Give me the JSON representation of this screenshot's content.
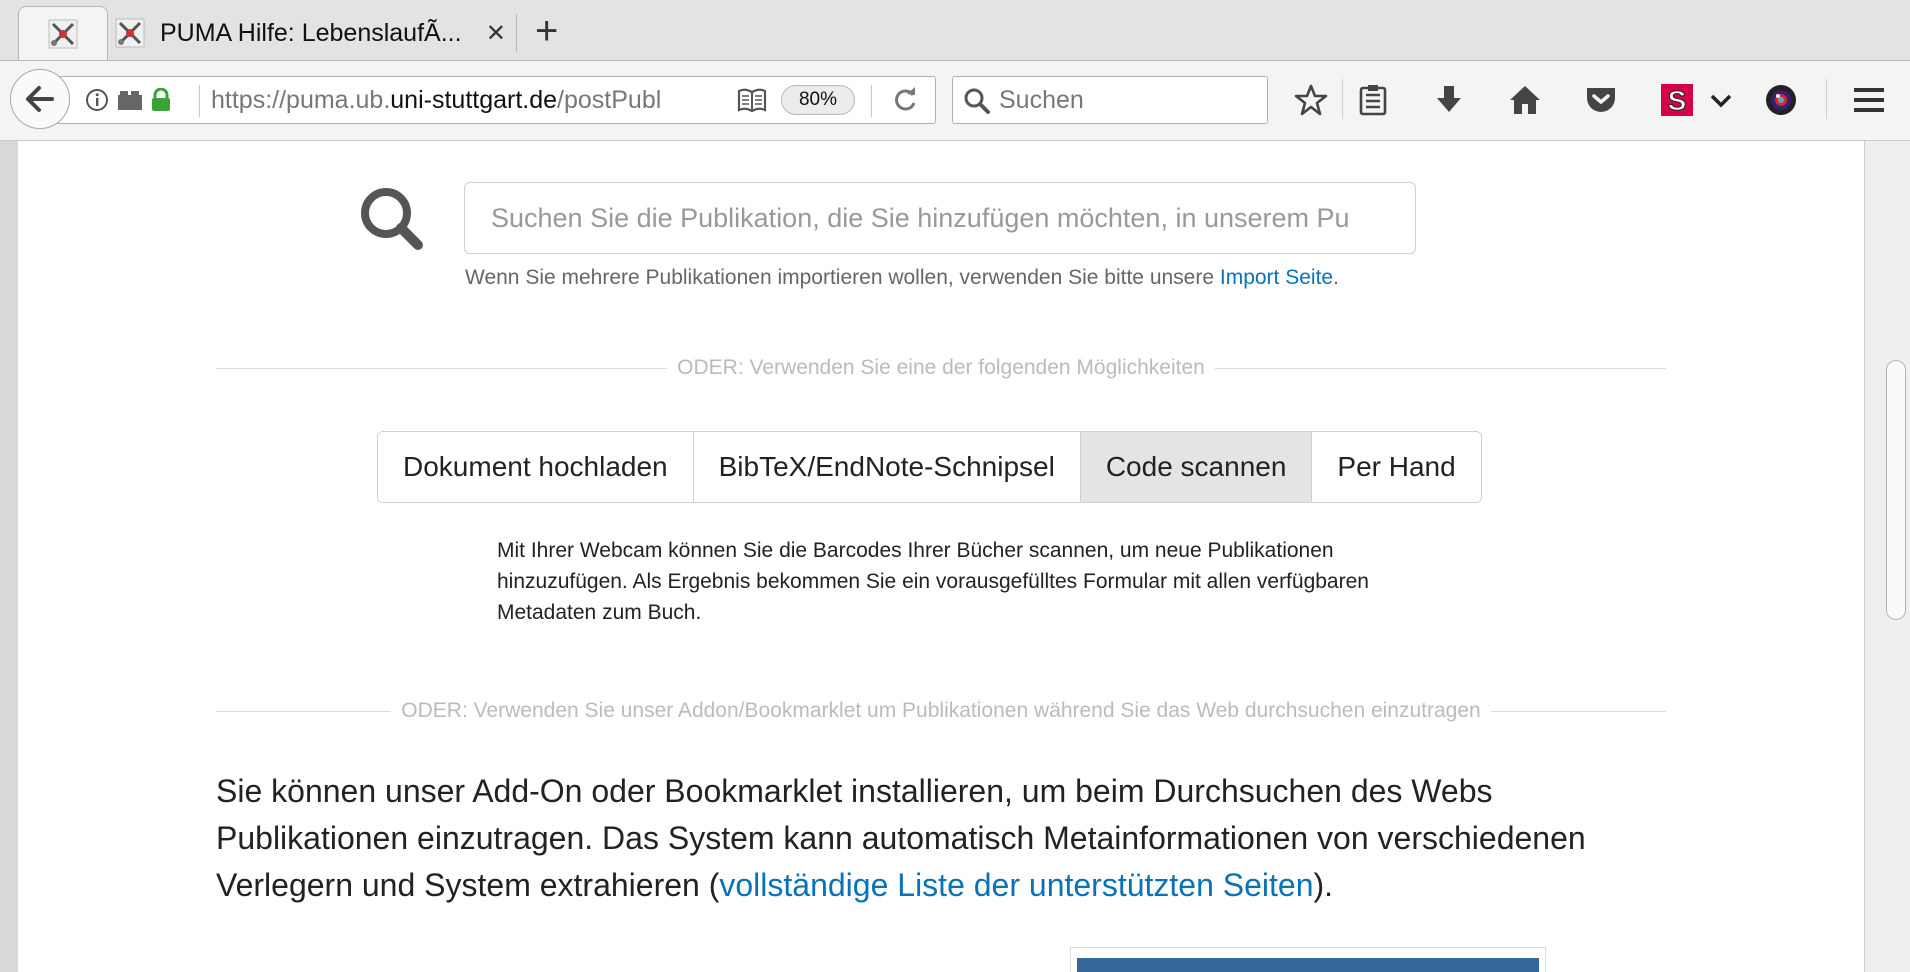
{
  "browser": {
    "tabs": [
      {
        "title": "",
        "icon": "puma-favicon",
        "active": true
      },
      {
        "title": "PUMA Hilfe: LebenslaufÃ...",
        "icon": "puma-favicon",
        "active": false
      }
    ],
    "close_glyph": "✕",
    "newtab_glyph": "+",
    "url": {
      "prefix": "https://puma.ub.",
      "domain": "uni-stuttgart.de",
      "path": "/postPubl"
    },
    "zoom": "80%",
    "search_placeholder": "Suchen",
    "accent_colors": {
      "pocket_badge": "#d7004a",
      "link": "#0a72b6"
    }
  },
  "page": {
    "search_placeholder": "Suchen Sie die Publikation, die Sie hinzufügen möchten, in unserem Pu",
    "hint_text": "Wenn Sie mehrere Publikationen importieren wollen, verwenden Sie bitte unsere ",
    "hint_link": "Import Seite",
    "hint_end": ".",
    "divider1": "ODER: Verwenden Sie eine der folgenden Möglichkeiten",
    "options": [
      "Dokument hochladen",
      "BibTeX/EndNote-Schnipsel",
      "Code scannen",
      "Per Hand"
    ],
    "active_option": "Code scannen",
    "description": "Mit Ihrer Webcam können Sie die Barcodes Ihrer Bücher scannen, um neue Publikationen hinzuzufügen. Als Ergebnis bekommen Sie ein vorausgefülltes Formular mit allen verfügbaren Metadaten zum Buch.",
    "divider2": "ODER: Verwenden Sie unser Addon/Bookmarklet um Publikationen während Sie das Web durchsuchen einzutragen",
    "para_text": "Sie können unser Add-On oder Bookmarklet installieren, um beim Durchsuchen des Webs Publikationen einzutragen. Das System kann automatisch Metainformationen von verschiedenen Verlegern und System extrahieren (",
    "para_link": "vollständige Liste der unterstützten Seiten",
    "para_end": ")."
  }
}
